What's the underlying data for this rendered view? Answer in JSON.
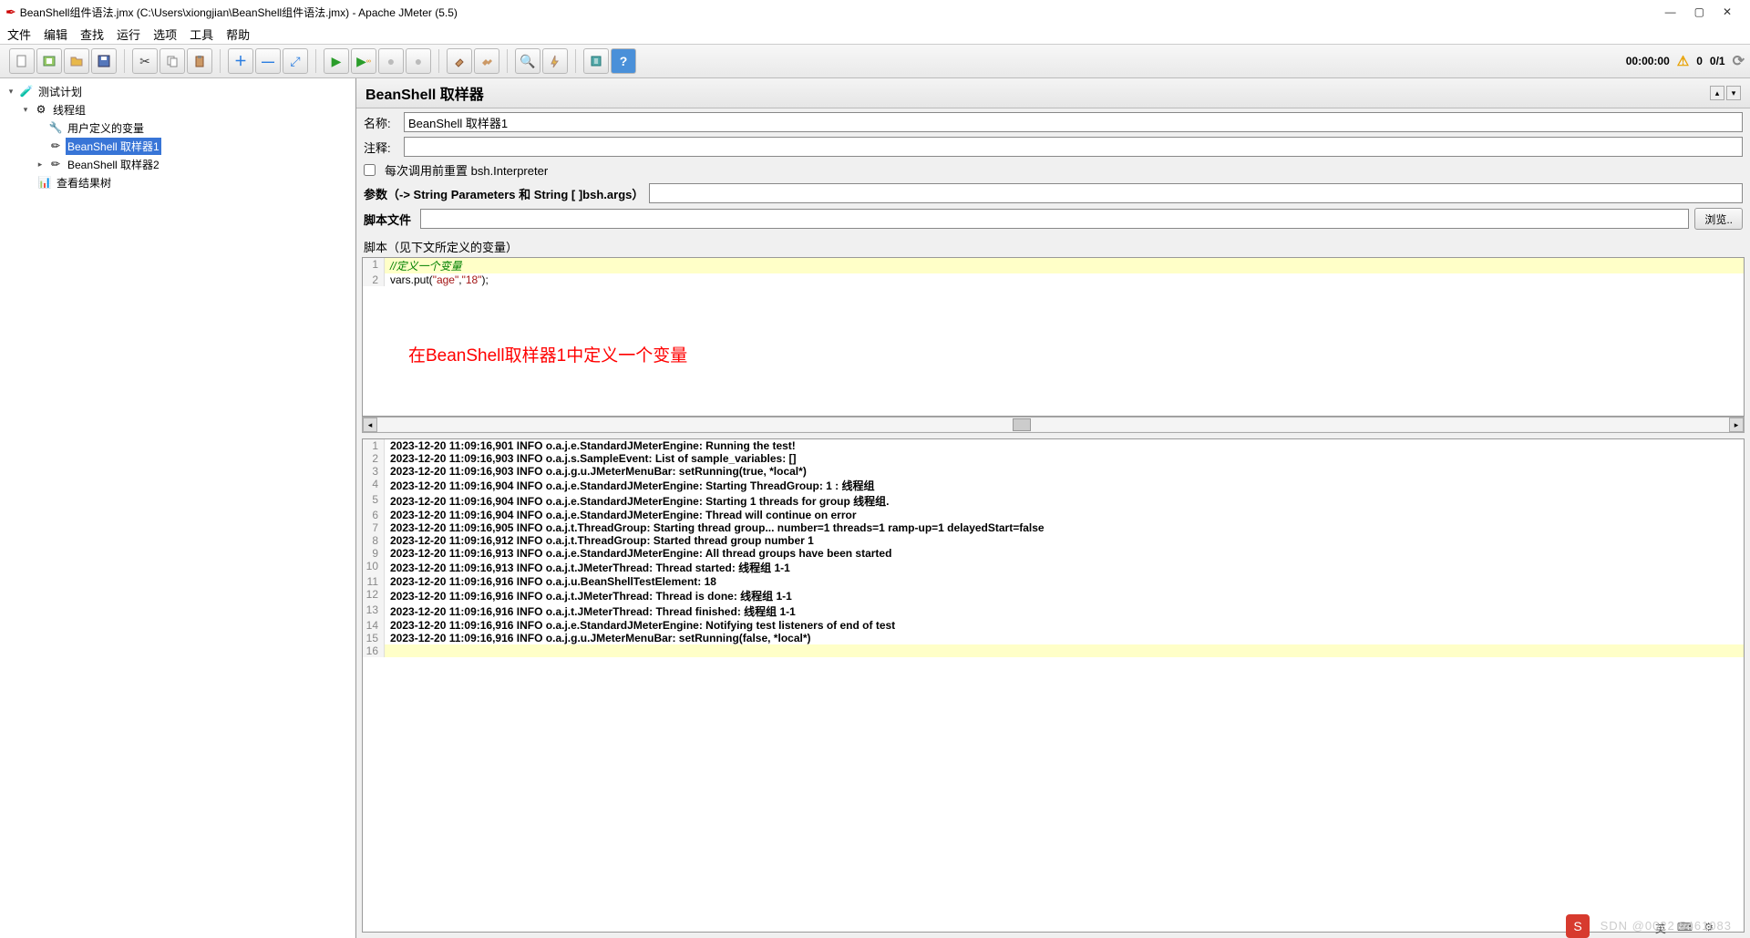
{
  "title": "BeanShell组件语法.jmx (C:\\Users\\xiongjian\\BeanShell组件语法.jmx) - Apache JMeter (5.5)",
  "menu": [
    "文件",
    "编辑",
    "查找",
    "运行",
    "选项",
    "工具",
    "帮助"
  ],
  "status": {
    "time": "00:00:00",
    "warn_count": "0",
    "threads": "0/1"
  },
  "tree": {
    "root": "测试计划",
    "thread_group": "线程组",
    "user_vars": "用户定义的变量",
    "sampler1": "BeanShell 取样器1",
    "sampler2": "BeanShell 取样器2",
    "results_tree": "查看结果树"
  },
  "panel": {
    "title": "BeanShell 取样器",
    "name_label": "名称:",
    "name_value": "BeanShell 取样器1",
    "comment_label": "注释:",
    "comment_value": "",
    "reset_label": "每次调用前重置 bsh.Interpreter",
    "params_label": "参数（-> String Parameters 和 String [ ]bsh.args）",
    "params_value": "",
    "scriptfile_label": "脚本文件",
    "scriptfile_value": "",
    "browse": "浏览..",
    "script_area_label": "脚本（见下文所定义的变量）"
  },
  "code": {
    "l1_comment": "//定义一个变量",
    "l2_a": "vars.put(",
    "l2_s1": "\"age\"",
    "l2_c": ",",
    "l2_s2": "\"18\"",
    "l2_b": ");"
  },
  "annotation": "在BeanShell取样器1中定义一个变量",
  "log": [
    "2023-12-20 11:09:16,901 INFO o.a.j.e.StandardJMeterEngine: Running the test!",
    "2023-12-20 11:09:16,903 INFO o.a.j.s.SampleEvent: List of sample_variables: []",
    "2023-12-20 11:09:16,903 INFO o.a.j.g.u.JMeterMenuBar: setRunning(true, *local*)",
    "2023-12-20 11:09:16,904 INFO o.a.j.e.StandardJMeterEngine: Starting ThreadGroup: 1 : 线程组",
    "2023-12-20 11:09:16,904 INFO o.a.j.e.StandardJMeterEngine: Starting 1 threads for group 线程组.",
    "2023-12-20 11:09:16,904 INFO o.a.j.e.StandardJMeterEngine: Thread will continue on error",
    "2023-12-20 11:09:16,905 INFO o.a.j.t.ThreadGroup: Starting thread group... number=1 threads=1 ramp-up=1 delayedStart=false",
    "2023-12-20 11:09:16,912 INFO o.a.j.t.ThreadGroup: Started thread group number 1",
    "2023-12-20 11:09:16,913 INFO o.a.j.e.StandardJMeterEngine: All thread groups have been started",
    "2023-12-20 11:09:16,913 INFO o.a.j.t.JMeterThread: Thread started: 线程组 1-1",
    "2023-12-20 11:09:16,916 INFO o.a.j.u.BeanShellTestElement: 18",
    "2023-12-20 11:09:16,916 INFO o.a.j.t.JMeterThread: Thread is done: 线程组 1-1",
    "2023-12-20 11:09:16,916 INFO o.a.j.t.JMeterThread: Thread finished: 线程组 1-1",
    "2023-12-20 11:09:16,916 INFO o.a.j.e.StandardJMeterEngine: Notifying test listeners of end of test",
    "2023-12-20 11:09:16,916 INFO o.a.j.g.u.JMeterMenuBar: setRunning(false, *local*)",
    ""
  ],
  "watermark": "SDN @0022 5461083",
  "ime": "S"
}
